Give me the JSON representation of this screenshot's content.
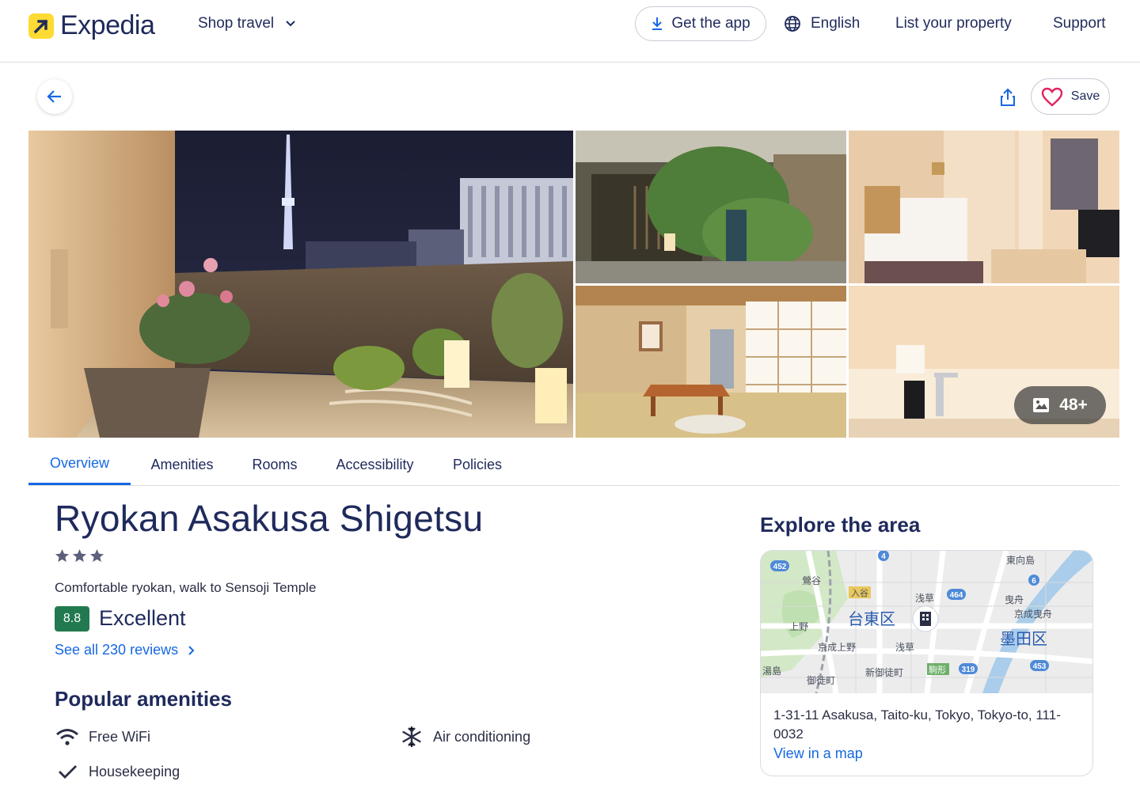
{
  "header": {
    "logo_text": "Expedia",
    "shop_travel": "Shop travel",
    "get_app": "Get the app",
    "language": "English",
    "list_property": "List your property",
    "support": "Support"
  },
  "actions": {
    "save_label": "Save"
  },
  "gallery": {
    "more_photos": "48+"
  },
  "tabs": [
    "Overview",
    "Amenities",
    "Rooms",
    "Accessibility",
    "Policies"
  ],
  "property": {
    "name": "Ryokan Asakusa Shigetsu",
    "star_count": 3,
    "tagline": "Comfortable ryokan, walk to Sensoji Temple",
    "rating": "8.8",
    "rating_word": "Excellent",
    "reviews_link": "See all 230 reviews"
  },
  "amenities": {
    "heading": "Popular amenities",
    "items": [
      {
        "icon": "wifi-icon",
        "label": "Free WiFi"
      },
      {
        "icon": "snowflake-icon",
        "label": "Air conditioning"
      },
      {
        "icon": "checkmark-icon",
        "label": "Housekeeping"
      }
    ]
  },
  "explore": {
    "heading": "Explore the area",
    "map_labels": {
      "taito": "台東区",
      "sumida": "墨田区",
      "asakusa": "浅草",
      "ueno": "上野",
      "keisei_ueno": "京成上野",
      "uguisudani": "鶯谷",
      "iriya": "入谷",
      "higashimukojima": "東向島",
      "hikifune": "曳舟",
      "keisei_hikifune": "京成曳舟",
      "yushima": "湯島",
      "okachimachi": "御徒町",
      "shin_okachimachi": "新御徒町",
      "komagata": "駒形",
      "asakusa_station": "浅草",
      "route_452": "452",
      "route_464": "464",
      "route_453": "453",
      "route_319": "319",
      "route_4": "4",
      "route_6": "6"
    },
    "address": "1-31-11 Asakusa, Taito-ku, Tokyo, Tokyo-to, 111-0032",
    "map_link": "View in a map"
  },
  "colors": {
    "brand_yellow": "#fddb32",
    "navy": "#1f2a5c",
    "link_blue": "#1668e3",
    "rating_green": "#227950",
    "heart_red": "#e0245e"
  }
}
